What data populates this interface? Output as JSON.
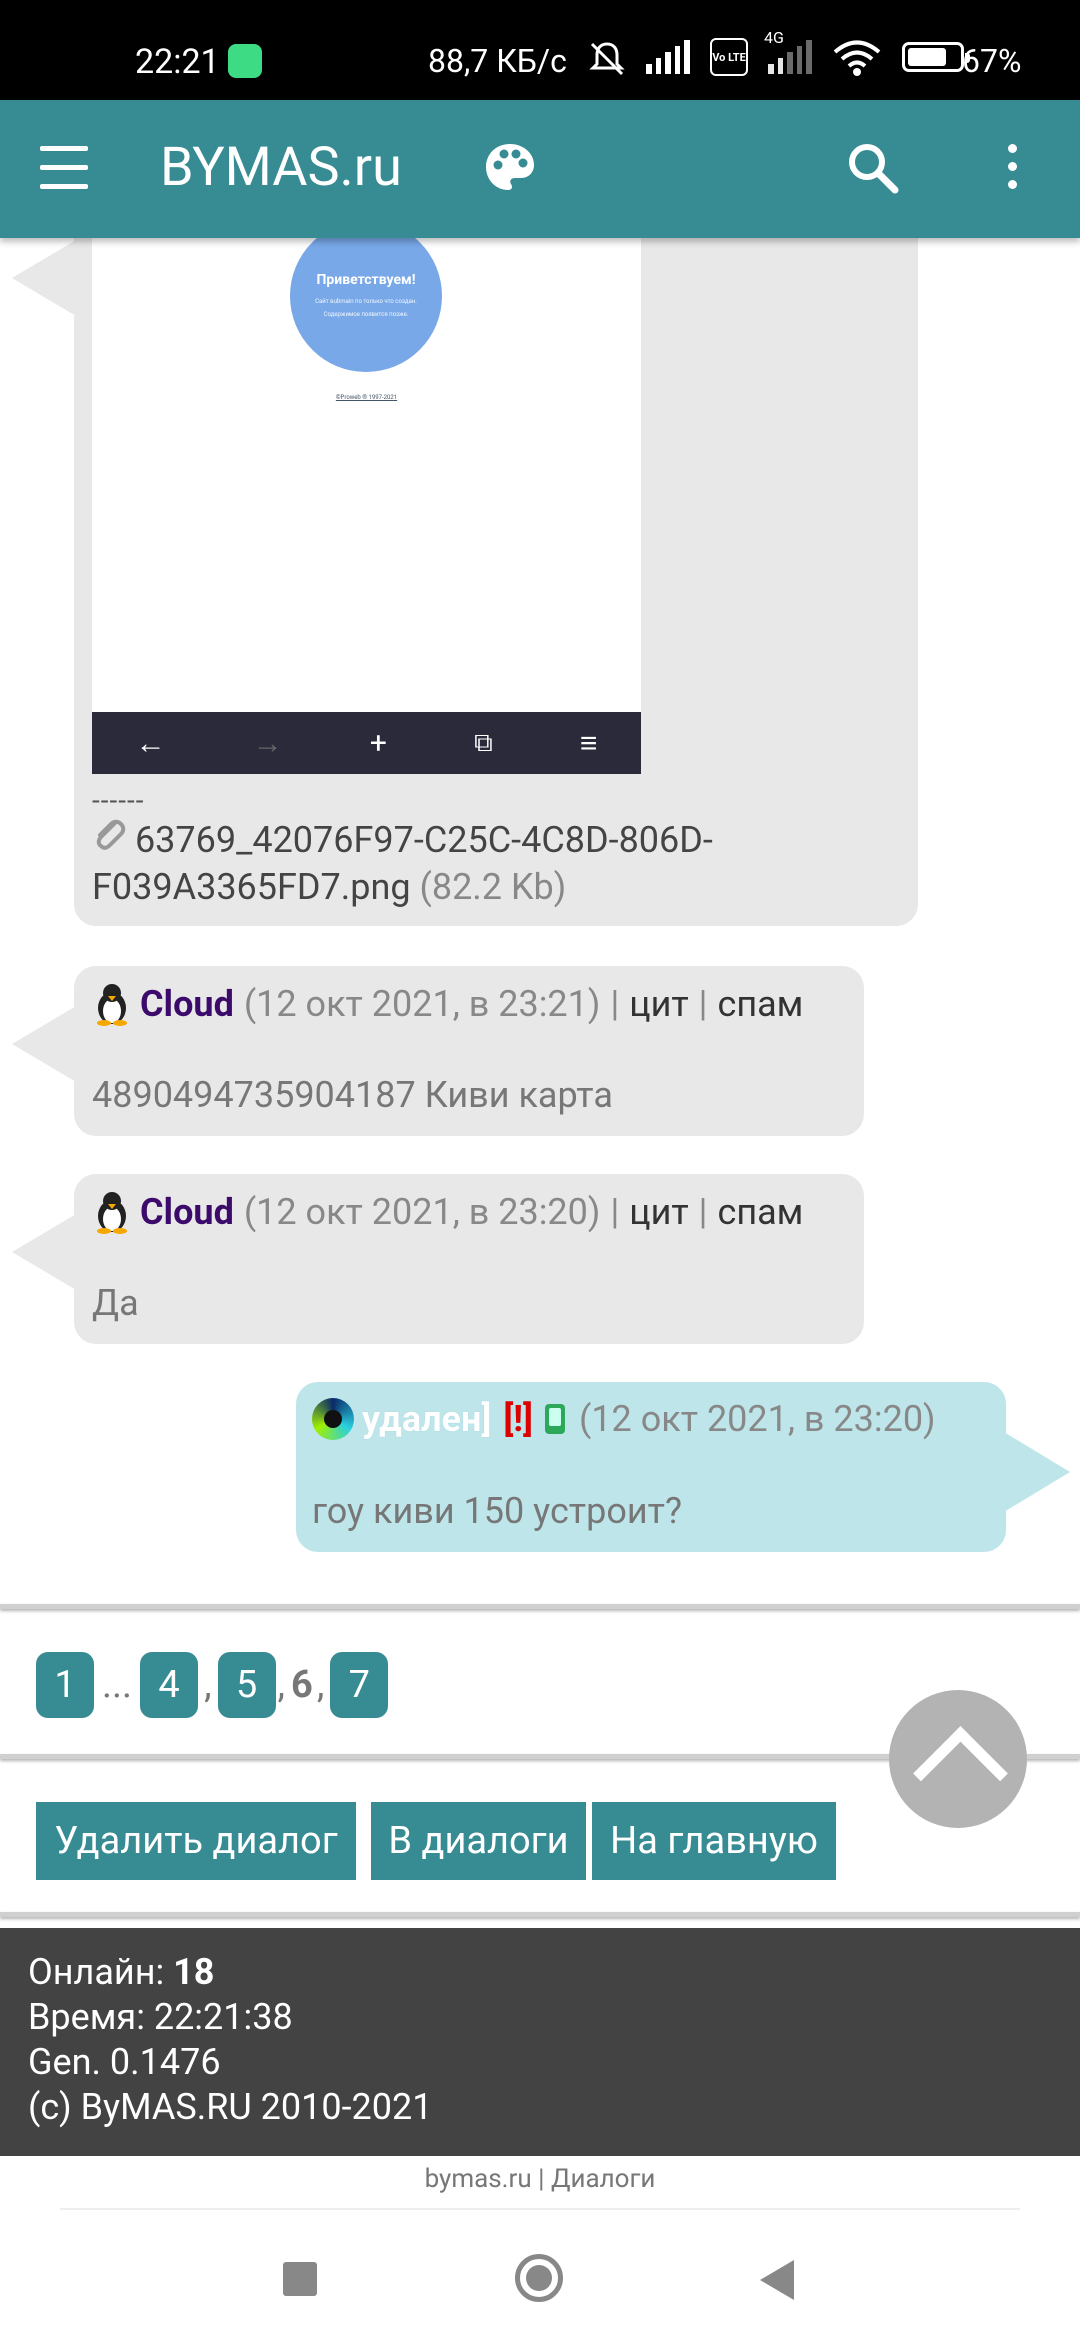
{
  "status_bar": {
    "time": "22:21",
    "network_speed": "88,7 КБ/с",
    "network_type": "4G",
    "volte": "Vo LTE",
    "battery": "67%",
    "battery_level": 0.67
  },
  "app_bar": {
    "title": "BYMAS.ru"
  },
  "attachment": {
    "preview": {
      "heading": "Приветствуем!",
      "line1": "Сайт вubmain по только что создан.",
      "line2": "Содержимое появится позже.",
      "footer_link": "©Proweb ® 1997-2021"
    },
    "separator": "------",
    "filename": "63769_42076F97-C25C-4C8D-806D-F039A3365FD7.png",
    "size": "(82.2 Kb)"
  },
  "messages": [
    {
      "author": "Cloud",
      "date": "(12 окт 2021, в 23:21)",
      "sep1": "|",
      "quote_link": "цит",
      "sep2": "|",
      "spam_link": "спам",
      "text": "4890494735904187 Киви карта"
    },
    {
      "author": "Cloud",
      "date": "(12 окт 2021, в 23:20)",
      "sep1": "|",
      "quote_link": "цит",
      "sep2": "|",
      "spam_link": "спам",
      "text": "Да"
    },
    {
      "author": "удален]",
      "flag": "[!]",
      "date": "(12 окт 2021, в 23:20)",
      "text": "гоу киви 150 устроит?"
    }
  ],
  "pagination": {
    "p1": "1",
    "ellipsis": "...",
    "p4": "4",
    "comma1": ",",
    "p5": "5",
    "comma2": ",",
    "current": "6",
    "comma3": ",",
    "p7": "7"
  },
  "buttons": {
    "delete": "Удалить диалог",
    "dialogs": "В диалоги",
    "home": "На главную"
  },
  "footer": {
    "online_label": "Онлайн:",
    "online_count": "18",
    "time_line": "Время: 22:21:38",
    "gen_line": "Gen. 0.1476",
    "copyright": "(c) ByMAS.RU 2010-2021"
  },
  "breadcrumb": {
    "site": "bymas.ru",
    "sep": "|",
    "section": "Диалоги"
  }
}
